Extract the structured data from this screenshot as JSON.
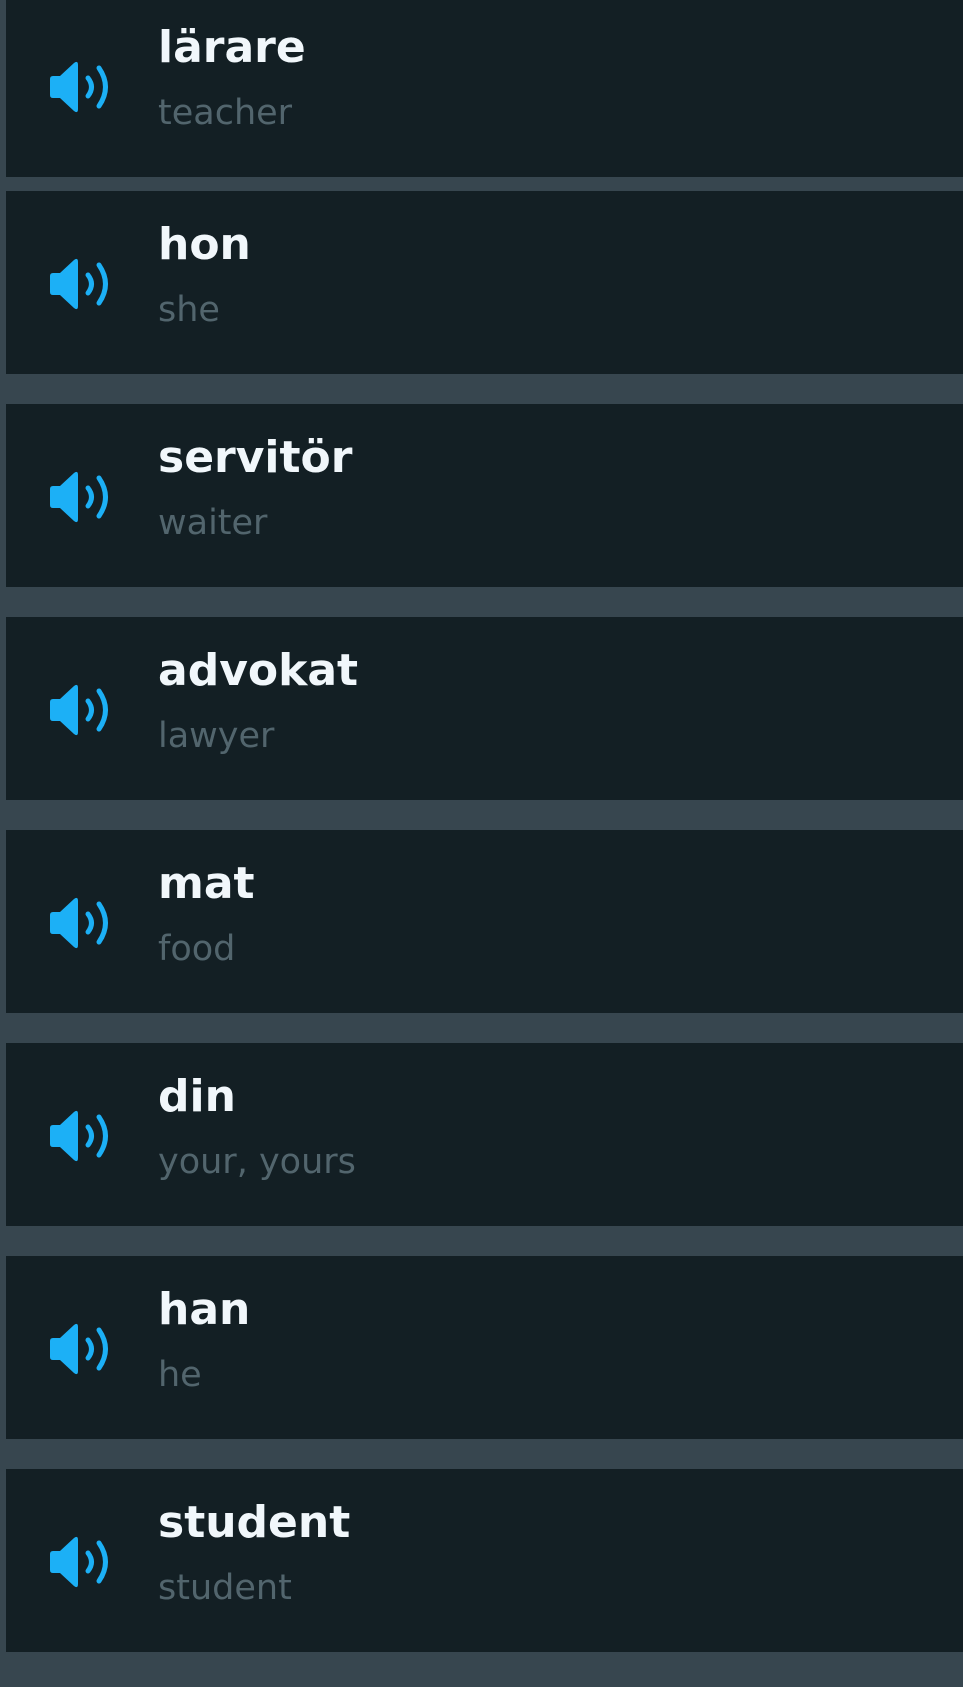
{
  "colors": {
    "background": "#131f24",
    "divider": "#37464f",
    "word": "#f1f7fb",
    "translation": "#52656d",
    "speaker_accent": "#1cb0f6"
  },
  "icons": {
    "speaker": "speaker-icon"
  },
  "words": [
    {
      "word": "lärare",
      "translation": "teacher"
    },
    {
      "word": "hon",
      "translation": "she"
    },
    {
      "word": "servitör",
      "translation": "waiter"
    },
    {
      "word": "advokat",
      "translation": "lawyer"
    },
    {
      "word": "mat",
      "translation": "food"
    },
    {
      "word": "din",
      "translation": "your, yours"
    },
    {
      "word": "han",
      "translation": "he"
    },
    {
      "word": "student",
      "translation": "student"
    }
  ]
}
